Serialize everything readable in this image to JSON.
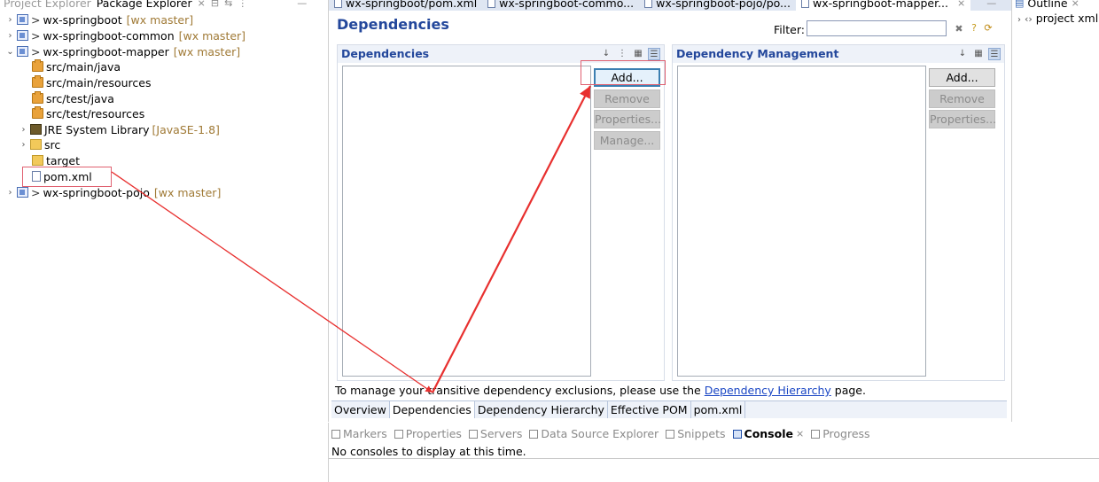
{
  "package_explorer": {
    "tabs": [
      "Project Explorer",
      "Package Explorer"
    ],
    "tree": [
      {
        "label": "wx-springboot",
        "prefix": ">",
        "git": "[wx master]",
        "twisty": ">"
      },
      {
        "label": "wx-springboot-common",
        "prefix": ">",
        "git": "[wx master]",
        "twisty": ">"
      },
      {
        "label": "wx-springboot-mapper",
        "prefix": ">",
        "git": "[wx master]",
        "twisty": "v"
      },
      {
        "label": "src/main/java"
      },
      {
        "label": "src/main/resources"
      },
      {
        "label": "src/test/java"
      },
      {
        "label": "src/test/resources"
      },
      {
        "label": "JRE System Library",
        "extra": "[JavaSE-1.8]",
        "twisty": ">"
      },
      {
        "label": "src",
        "twisty": ">"
      },
      {
        "label": "target"
      },
      {
        "label": "pom.xml"
      },
      {
        "label": "wx-springboot-pojo",
        "prefix": ">",
        "git": "[wx master]",
        "twisty": ">"
      }
    ]
  },
  "editor": {
    "tabs": [
      "wx-springboot/pom.xml",
      "wx-springboot-commo...",
      "wx-springboot-pojo/po...",
      "wx-springboot-mapper..."
    ],
    "title": "Dependencies",
    "filter_label": "Filter:",
    "filter_value": "",
    "dependencies_section": {
      "title": "Dependencies",
      "buttons": [
        "Add...",
        "Remove",
        "Properties...",
        "Manage..."
      ]
    },
    "dependency_management_section": {
      "title": "Dependency Management",
      "buttons": [
        "Add...",
        "Remove",
        "Properties..."
      ]
    },
    "hint_prefix": "To manage your transitive dependency exclusions, please use the",
    "hint_link": "Dependency Hierarchy",
    "hint_suffix": "page.",
    "page_tabs": [
      "Overview",
      "Dependencies",
      "Dependency Hierarchy",
      "Effective POM",
      "pom.xml"
    ],
    "active_page_tab": "Dependencies"
  },
  "outline": {
    "tab": "Outline",
    "item": "project xml"
  },
  "console": {
    "tabs": [
      "Markers",
      "Properties",
      "Servers",
      "Data Source Explorer",
      "Snippets",
      "Console",
      "Progress"
    ],
    "active_tab": "Console",
    "message": "No consoles to display at this time."
  },
  "annotation_color": "#e8302f"
}
